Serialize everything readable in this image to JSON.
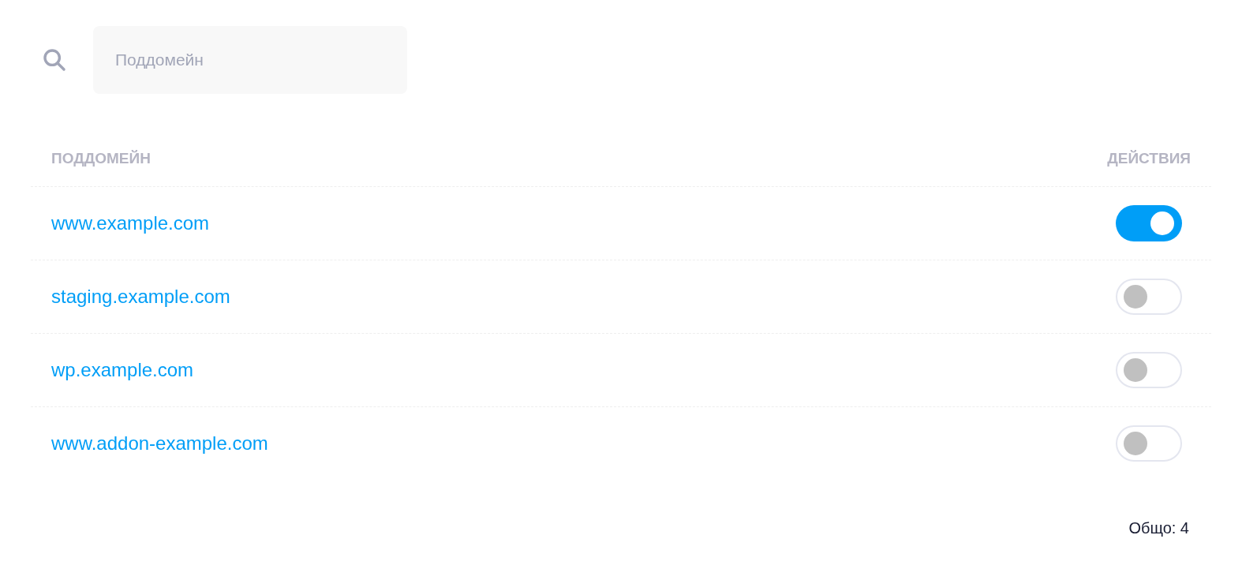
{
  "search": {
    "placeholder": "Поддомейн"
  },
  "table": {
    "columns": [
      "ПОДДОМЕЙН",
      "ДЕЙСТВИЯ"
    ],
    "rows": [
      {
        "subdomain": "www.example.com",
        "on": true
      },
      {
        "subdomain": "staging.example.com",
        "on": false
      },
      {
        "subdomain": "wp.example.com",
        "on": false
      },
      {
        "subdomain": "www.addon-example.com",
        "on": false
      }
    ]
  },
  "footer": {
    "total": "Общо: 4"
  }
}
